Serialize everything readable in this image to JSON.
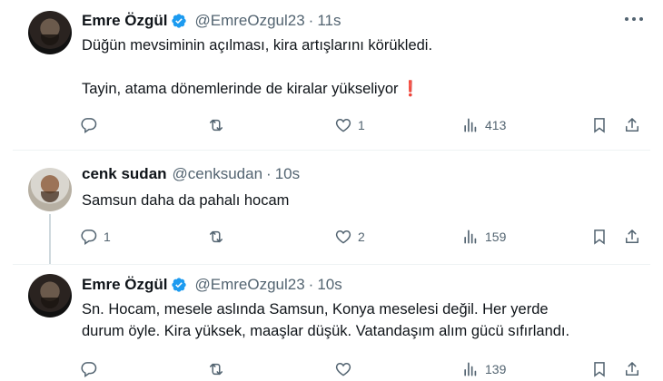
{
  "tweets": [
    {
      "name": "Emre Özgül",
      "handle": "@EmreOzgul23",
      "dot": "·",
      "time": "11s",
      "lines": [
        "Düğün mevsiminin açılması, kira artışlarını körükledi."
      ],
      "line2": "Tayin, atama dönemlerinde de kiralar yükseliyor",
      "emoji": "❗",
      "reply_count": "",
      "retweet_count": "",
      "like_count": "1",
      "view_count": "413"
    },
    {
      "name": "cenk sudan",
      "handle": "@cenksudan",
      "dot": "·",
      "time": "10s",
      "text": "Samsun daha da pahalı hocam",
      "reply_count": "1",
      "retweet_count": "",
      "like_count": "2",
      "view_count": "159"
    },
    {
      "name": "Emre Özgül",
      "handle": "@EmreOzgul23",
      "dot": "·",
      "time": "10s",
      "line1": "Sn. Hocam, mesele aslında Samsun, Konya meselesi değil. Her yerde",
      "line2": "durum öyle. Kira yüksek, maaşlar düşük. Vatandaşım alım gücü sıfırlandı.",
      "reply_count": "",
      "retweet_count": "",
      "like_count": "",
      "view_count": "139"
    }
  ],
  "colors": {
    "verified": "#1d9bf0",
    "muted": "#536471",
    "text": "#0f1419",
    "alert": "#d81d2c"
  },
  "icons": [
    "verified-badge-icon",
    "more-icon",
    "reply-icon",
    "retweet-icon",
    "like-icon",
    "views-icon",
    "bookmark-icon",
    "share-icon"
  ]
}
